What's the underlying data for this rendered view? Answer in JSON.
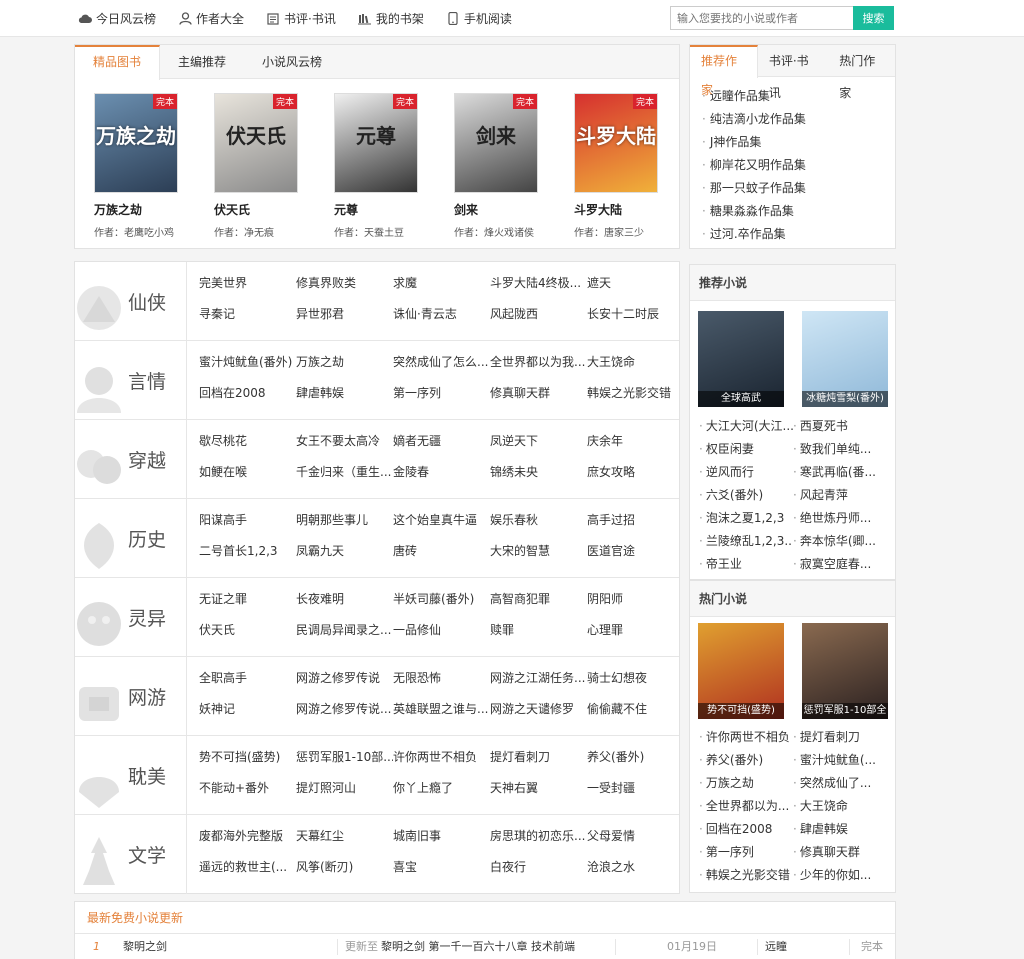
{
  "nav": [
    {
      "label": "今日风云榜",
      "icon": "cloud-icon"
    },
    {
      "label": "作者大全",
      "icon": "user-icon"
    },
    {
      "label": "书评·书讯",
      "icon": "review-icon"
    },
    {
      "label": "我的书架",
      "icon": "bookshelf-icon"
    },
    {
      "label": "手机阅读",
      "icon": "mobile-icon"
    }
  ],
  "search": {
    "placeholder": "输入您要找的小说或作者",
    "button": "搜索"
  },
  "featured": {
    "tabs": [
      "精品图书",
      "主编推荐",
      "小说风云榜"
    ],
    "books": [
      {
        "title": "万族之劫",
        "author": "作者：老鹰吃小鸡",
        "badge": "完本",
        "cover_text": "万族之劫",
        "color1": "#6b8fb0",
        "color2": "#2c3e55"
      },
      {
        "title": "伏天氏",
        "author": "作者：净无痕",
        "badge": "完本",
        "cover_text": "伏天氏",
        "color1": "#e8e4dc",
        "color2": "#8a8a8a"
      },
      {
        "title": "元尊",
        "author": "作者：天蚕土豆",
        "badge": "完本",
        "cover_text": "元尊",
        "color1": "#f0f0f0",
        "color2": "#333333"
      },
      {
        "title": "剑来",
        "author": "作者：烽火戏诸侯",
        "badge": "完本",
        "cover_text": "剑来",
        "color1": "#dcdcdc",
        "color2": "#444444"
      },
      {
        "title": "斗罗大陆",
        "author": "作者：唐家三少",
        "badge": "完本",
        "cover_text": "斗罗大陆",
        "color1": "#d6302f",
        "color2": "#f0b13a"
      }
    ]
  },
  "authors": {
    "tabs": [
      "推荐作家",
      "书评·书讯",
      "热门作家"
    ],
    "items": [
      "远瞳作品集",
      "纯洁滴小龙作品集",
      "J神作品集",
      "柳岸花又明作品集",
      "那一只蚊子作品集",
      "糖果淼淼作品集",
      "过河.卒作品集"
    ]
  },
  "categories": [
    {
      "name": "仙侠",
      "icon": "xianxia-icon",
      "books": [
        "完美世界",
        "修真界败类",
        "求魔",
        "斗罗大陆4终极...",
        "遮天",
        "寻秦记",
        "异世邪君",
        "诛仙·青云志",
        "风起陇西",
        "长安十二时辰"
      ]
    },
    {
      "name": "言情",
      "icon": "romance-icon",
      "books": [
        "蜜汁炖鱿鱼(番外)",
        "万族之劫",
        "突然成仙了怎么...",
        "全世界都以为我...",
        "大王饶命",
        "回档在2008",
        "肆虐韩娱",
        "第一序列",
        "修真聊天群",
        "韩娱之光影交错"
      ]
    },
    {
      "name": "穿越",
      "icon": "timetravel-icon",
      "books": [
        "歇尽桃花",
        "女王不要太高冷",
        "嫡者无疆",
        "凤逆天下",
        "庆余年",
        "如鲠在喉",
        "千金归来（重生...",
        "金陵春",
        "锦绣未央",
        "庶女攻略"
      ]
    },
    {
      "name": "历史",
      "icon": "history-icon",
      "books": [
        "阳谋高手",
        "明朝那些事儿",
        "这个始皇真牛逼",
        "娱乐春秋",
        "高手过招",
        "二号首长1,2,3",
        "凤霸九天",
        "唐砖",
        "大宋的智慧",
        "医道官途"
      ]
    },
    {
      "name": "灵异",
      "icon": "supernatural-icon",
      "books": [
        "无证之罪",
        "长夜难明",
        "半妖司藤(番外)",
        "高智商犯罪",
        "阴阳师",
        "伏天氏",
        "民调局异闻录之...",
        "一品修仙",
        "赎罪",
        "心理罪"
      ]
    },
    {
      "name": "网游",
      "icon": "game-icon",
      "books": [
        "全职高手",
        "网游之修罗传说",
        "无限恐怖",
        "网游之江湖任务...",
        "骑士幻想夜",
        "妖神记",
        "网游之修罗传说...",
        "英雄联盟之谁与...",
        "网游之天谴修罗",
        "偷偷藏不住"
      ]
    },
    {
      "name": "耽美",
      "icon": "danmei-icon",
      "books": [
        "势不可挡(盛势)",
        "惩罚军服1-10部...",
        "许你两世不相负",
        "提灯看刺刀",
        "养父(番外)",
        "不能动+番外",
        "提灯照河山",
        "你丫上瘾了",
        "天神右翼",
        "一受封疆"
      ]
    },
    {
      "name": "文学",
      "icon": "literature-icon",
      "books": [
        "废都海外完整版",
        "天幕红尘",
        "城南旧事",
        "房思琪的初恋乐...",
        "父母爱情",
        "遥远的救世主(...",
        "风筝(断刃)",
        "喜宝",
        "白夜行",
        "沧浪之水"
      ]
    }
  ],
  "recommend": {
    "title": "推荐小说",
    "covers": [
      {
        "caption": "全球高武",
        "color1": "#4a5a6a",
        "color2": "#1a2430"
      },
      {
        "caption": "冰糖炖雪梨(番外)",
        "color1": "#cfe6f5",
        "color2": "#8fb8d8"
      }
    ],
    "items": [
      "大江大河(大江...",
      "西夏死书",
      "权臣闲妻",
      "致我们单纯...",
      "逆风而行",
      "寒武再临(番...",
      "六爻(番外)",
      "风起青萍",
      "泡沫之夏1,2,3",
      "绝世炼丹师...",
      "兰陵缭乱1,2,3...",
      "奔本惊华(卿...",
      "帝王业",
      "寂寞空庭春..."
    ]
  },
  "hot": {
    "title": "热门小说",
    "covers": [
      {
        "caption": "势不可挡(盛势)",
        "color1": "#e0a030",
        "color2": "#b03020"
      },
      {
        "caption": "惩罚军服1-10部全",
        "color1": "#8a6a50",
        "color2": "#2a2020"
      }
    ],
    "items": [
      "许你两世不相负",
      "提灯看刺刀",
      "养父(番外)",
      "蜜汁炖鱿鱼(...",
      "万族之劫",
      "突然成仙了...",
      "全世界都以为...",
      "大王饶命",
      "回档在2008",
      "肆虐韩娱",
      "第一序列",
      "修真聊天群",
      "韩娱之光影交错",
      "少年的你如..."
    ]
  },
  "latest": {
    "title": "最新免费小说更新",
    "rows": [
      {
        "rank": "1",
        "book": "黎明之剑",
        "update_prefix": "更新至",
        "chapter": "黎明之剑 第一千一百六十八章 技术前端",
        "date": "01月19日",
        "author": "远瞳",
        "status": "完本"
      }
    ]
  },
  "colors": {
    "accent": "#e4823b",
    "search_button": "#1abc9c",
    "badge": "#d9232d"
  }
}
